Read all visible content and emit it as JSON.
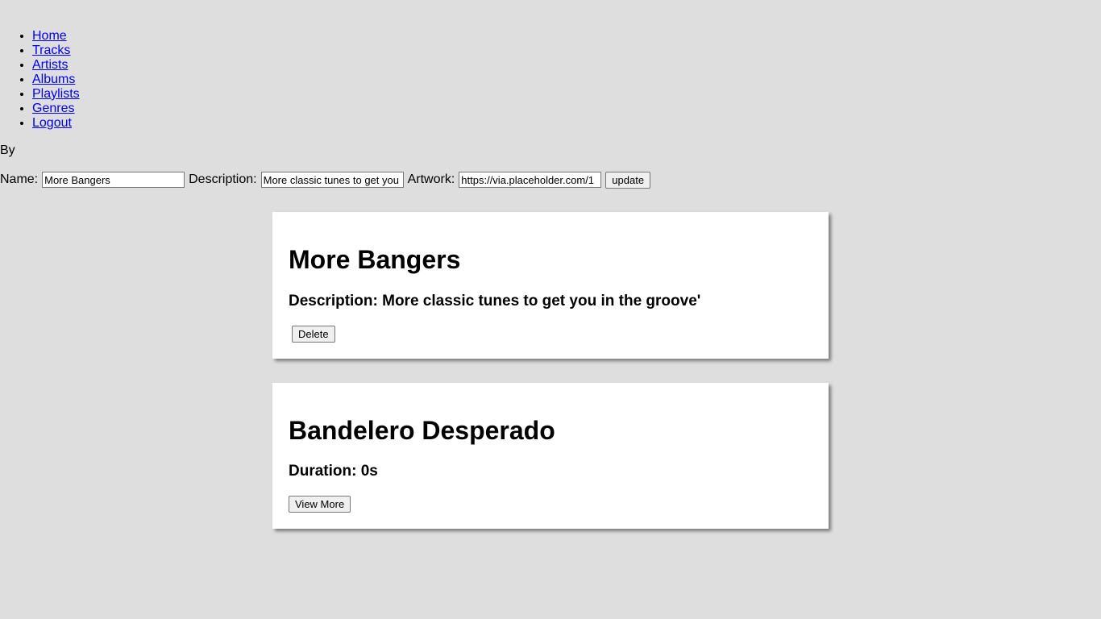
{
  "nav": {
    "items": [
      {
        "label": "Home"
      },
      {
        "label": "Tracks"
      },
      {
        "label": "Artists"
      },
      {
        "label": "Albums"
      },
      {
        "label": "Playlists"
      },
      {
        "label": "Genres"
      },
      {
        "label": "Logout"
      }
    ]
  },
  "by_label": "By",
  "form": {
    "name_label": "Name:",
    "name_value": "More Bangers",
    "description_label": "Description:",
    "description_value": "More classic tunes to get you in the groove'",
    "artwork_label": "Artwork:",
    "artwork_value": "https://via.placeholder.com/1",
    "update_label": "update"
  },
  "playlist": {
    "title": "More Bangers",
    "description_line": "Description: More classic tunes to get you in the groove'",
    "delete_label": "Delete"
  },
  "track": {
    "title": "Bandelero Desperado",
    "duration_line": "Duration: 0s",
    "view_more_label": "View More"
  },
  "colors": {
    "background": "#dedede",
    "link": "#0000ee",
    "card": "#ffffff"
  }
}
